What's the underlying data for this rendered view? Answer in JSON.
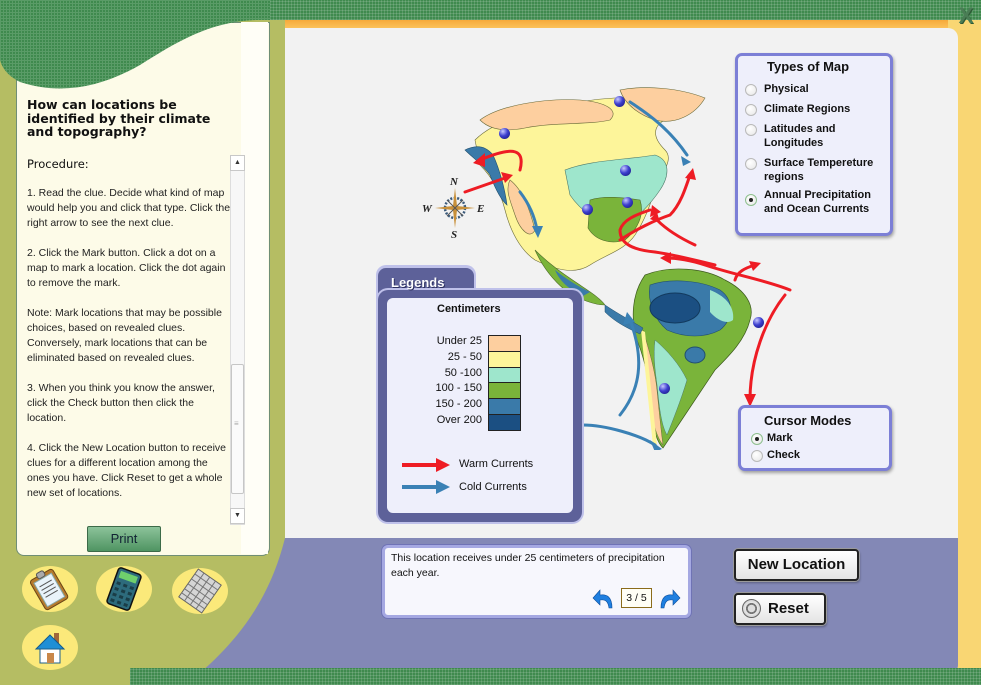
{
  "window": {
    "close_label": "X"
  },
  "left_panel": {
    "question": "How can locations be identified by their climate and topography?",
    "procedure_title": "Procedure:",
    "steps": [
      "1. Read the clue. Decide what kind of map would help you and click that type. Click the right arrow to see the next clue.",
      "2. Click the Mark button. Click a dot on a map to mark a location. Click the dot again to remove the mark.",
      "Note: Mark locations that may be possible choices, based on revealed clues. Conversely, mark locations that can be eliminated based on revealed clues.",
      "3. When you think you know the answer, click the Check button then click the location.",
      "4. Click the New Location button to receive clues for a different location among the ones you have. Click Reset to get a whole new set of locations."
    ],
    "print_label": "Print",
    "tools": [
      {
        "name": "clipboard-icon"
      },
      {
        "name": "calculator-icon"
      },
      {
        "name": "spreadsheet-icon"
      },
      {
        "name": "home-icon"
      }
    ]
  },
  "types_of_map": {
    "title": "Types of Map",
    "options": [
      {
        "label": "Physical",
        "selected": false
      },
      {
        "label": "Climate Regions",
        "selected": false
      },
      {
        "label": "Latitudes and\nLongitudes",
        "selected": false
      },
      {
        "label": "Surface Tempereture\nregions",
        "selected": false
      },
      {
        "label": "Annual Precipitation\nand Ocean Currents",
        "selected": true
      }
    ]
  },
  "legend": {
    "title": "Legends",
    "unit": "Centimeters",
    "bins": [
      {
        "label": "Under 25",
        "color": "#fdcf9f"
      },
      {
        "label": "25 - 50",
        "color": "#fdf59a"
      },
      {
        "label": "50 -100",
        "color": "#9ee6cc"
      },
      {
        "label": "100 - 150",
        "color": "#7ab43a"
      },
      {
        "label": "150 - 200",
        "color": "#3a7aa9"
      },
      {
        "label": "Over 200",
        "color": "#1b4f82"
      }
    ],
    "currents": [
      {
        "label": "Warm Currents",
        "color": "#ee1c24"
      },
      {
        "label": "Cold Currents",
        "color": "#3a81b5"
      }
    ]
  },
  "compass": {
    "n": "N",
    "s": "S",
    "e": "E",
    "w": "W"
  },
  "cursor_modes": {
    "title": "Cursor Modes",
    "options": [
      {
        "label": "Mark",
        "selected": true
      },
      {
        "label": "Check",
        "selected": false
      }
    ]
  },
  "clue": {
    "text": "This location receives under 25 centimeters of precipitation each year.",
    "counter": "3 / 5",
    "current": 3,
    "total": 5
  },
  "buttons": {
    "new_location": "New Location",
    "reset": "Reset"
  },
  "map_markers_count": 8
}
